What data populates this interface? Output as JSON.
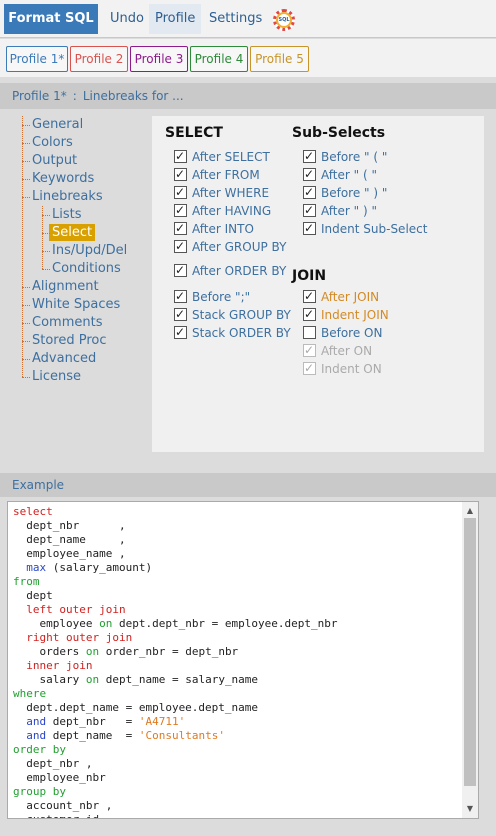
{
  "menu": {
    "brand": "Format SQL",
    "undo": "Undo",
    "profile": "Profile",
    "settings": "Settings",
    "logo_text": "SQL"
  },
  "profiles": [
    {
      "label": "Profile 1*",
      "color": "#3d7ab8"
    },
    {
      "label": "Profile 2",
      "color": "#d9534f"
    },
    {
      "label": "Profile 3",
      "color": "#8e1a8e"
    },
    {
      "label": "Profile 4",
      "color": "#2e8b3a"
    },
    {
      "label": "Profile 5",
      "color": "#c7952a"
    }
  ],
  "breadcrumb": {
    "profile": "Profile 1*",
    "separator": ":",
    "section": "Linebreaks for ..."
  },
  "tree": {
    "general": "General",
    "colors": "Colors",
    "output": "Output",
    "keywords": "Keywords",
    "linebreaks": "Linebreaks",
    "lists": "Lists",
    "select": "Select",
    "insupddel": "Ins/Upd/Del",
    "conditions": "Conditions",
    "alignment": "Alignment",
    "whitespaces": "White Spaces",
    "comments": "Comments",
    "storedproc": "Stored Proc",
    "advanced": "Advanced",
    "license": "License"
  },
  "select_section": {
    "title": "SELECT",
    "options": [
      {
        "label": "After SELECT",
        "checked": true
      },
      {
        "label": "After FROM",
        "checked": true
      },
      {
        "label": "After WHERE",
        "checked": true
      },
      {
        "label": "After HAVING",
        "checked": true
      },
      {
        "label": "After INTO",
        "checked": true
      },
      {
        "label": "After GROUP BY",
        "checked": true
      },
      {
        "label": "After ORDER BY",
        "checked": true
      },
      {
        "label": "Before \";\"",
        "checked": true
      },
      {
        "label": "Stack GROUP BY",
        "checked": true
      },
      {
        "label": "Stack ORDER BY",
        "checked": true
      }
    ]
  },
  "subselect_section": {
    "title": "Sub-Selects",
    "options": [
      {
        "label": "Before \" ( \"",
        "checked": true
      },
      {
        "label": "After \" ( \"",
        "checked": true
      },
      {
        "label": "Before \" ) \"",
        "checked": true
      },
      {
        "label": "After \" ) \"",
        "checked": true
      },
      {
        "label": "Indent Sub-Select",
        "checked": true
      }
    ]
  },
  "join_section": {
    "title": "JOIN",
    "options": [
      {
        "label": "After JOIN",
        "checked": true,
        "style": "orange"
      },
      {
        "label": "Indent JOIN",
        "checked": true,
        "style": "orange"
      },
      {
        "label": "Before ON",
        "checked": false,
        "style": "normal"
      },
      {
        "label": "After ON",
        "checked": true,
        "style": "disabled"
      },
      {
        "label": "Indent ON",
        "checked": true,
        "style": "disabled"
      }
    ]
  },
  "example": {
    "header": "Example",
    "lines": [
      [
        [
          "kw-red",
          "select"
        ]
      ],
      [
        [
          "",
          "  dept_nbr      ,"
        ]
      ],
      [
        [
          "",
          "  dept_name     ,"
        ]
      ],
      [
        [
          "",
          "  employee_name ,"
        ]
      ],
      [
        [
          "",
          "  "
        ],
        [
          "kw-blue",
          "max"
        ],
        [
          "",
          " (salary_amount)"
        ]
      ],
      [
        [
          "kw-green",
          "from"
        ]
      ],
      [
        [
          "",
          "  dept"
        ]
      ],
      [
        [
          "",
          "  "
        ],
        [
          "kw-red",
          "left outer join"
        ]
      ],
      [
        [
          "",
          "    employee "
        ],
        [
          "kw-green",
          "on"
        ],
        [
          "",
          " dept.dept_nbr = employee.dept_nbr"
        ]
      ],
      [
        [
          "",
          "  "
        ],
        [
          "kw-red",
          "right outer join"
        ]
      ],
      [
        [
          "",
          "    orders "
        ],
        [
          "kw-green",
          "on"
        ],
        [
          "",
          " order_nbr = dept_nbr"
        ]
      ],
      [
        [
          "",
          "  "
        ],
        [
          "kw-red",
          "inner join"
        ]
      ],
      [
        [
          "",
          "    salary "
        ],
        [
          "kw-green",
          "on"
        ],
        [
          "",
          " dept_name = salary_name"
        ]
      ],
      [
        [
          "kw-green",
          "where"
        ]
      ],
      [
        [
          "",
          "  dept.dept_name = employee.dept_name"
        ]
      ],
      [
        [
          "",
          "  "
        ],
        [
          "kw-blue",
          "and"
        ],
        [
          "",
          " dept_nbr   = "
        ],
        [
          "str",
          "'A4711'"
        ]
      ],
      [
        [
          "",
          "  "
        ],
        [
          "kw-blue",
          "and"
        ],
        [
          "",
          " dept_name  = "
        ],
        [
          "str",
          "'Consultants'"
        ]
      ],
      [
        [
          "kw-green",
          "order by"
        ]
      ],
      [
        [
          "",
          "  dept_nbr ,"
        ]
      ],
      [
        [
          "",
          "  employee_nbr"
        ]
      ],
      [
        [
          "kw-green",
          "group by"
        ]
      ],
      [
        [
          "",
          "  account_nbr ,"
        ]
      ],
      [
        [
          "",
          "  customer_id"
        ]
      ]
    ]
  }
}
